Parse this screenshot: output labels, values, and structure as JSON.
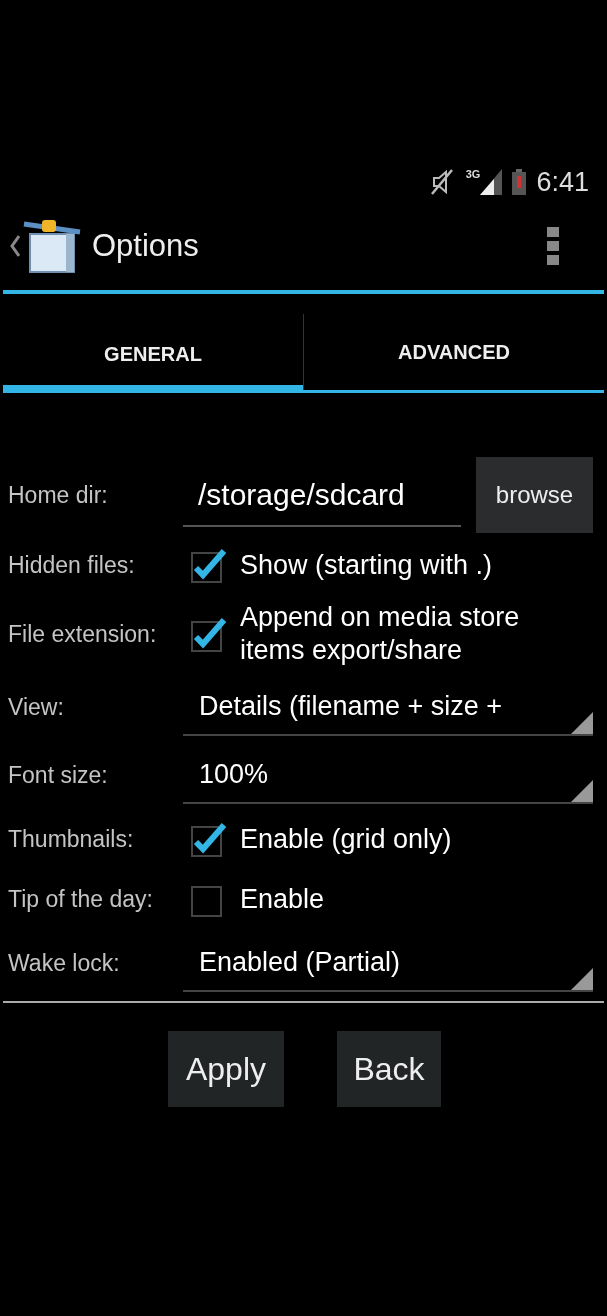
{
  "status_bar": {
    "network": "3G",
    "time": "6:41"
  },
  "action_bar": {
    "title": "Options"
  },
  "tabs": [
    {
      "label": "GENERAL",
      "selected": true
    },
    {
      "label": "ADVANCED",
      "selected": false
    }
  ],
  "rows": [
    {
      "kind": "field",
      "label": "Home dir:",
      "value": "/storage/sdcard",
      "button": "browse"
    },
    {
      "kind": "checkbox",
      "label": "Hidden files:",
      "text": "Show (starting with .)",
      "checked": true
    },
    {
      "kind": "checkbox",
      "label": "File extension:",
      "text": "Append on media store items export/share",
      "checked": true
    },
    {
      "kind": "dropdown",
      "label": "View:",
      "value": "Details (filename + size +"
    },
    {
      "kind": "dropdown",
      "label": "Font size:",
      "value": "100%"
    },
    {
      "kind": "checkbox",
      "label": "Thumbnails:",
      "text": "Enable (grid only)",
      "checked": true
    },
    {
      "kind": "checkbox",
      "label": "Tip of the day:",
      "text": "Enable",
      "checked": false
    },
    {
      "kind": "dropdown",
      "label": "Wake lock:",
      "value": "Enabled (Partial)"
    }
  ],
  "buttons": [
    "Apply",
    "Back"
  ]
}
